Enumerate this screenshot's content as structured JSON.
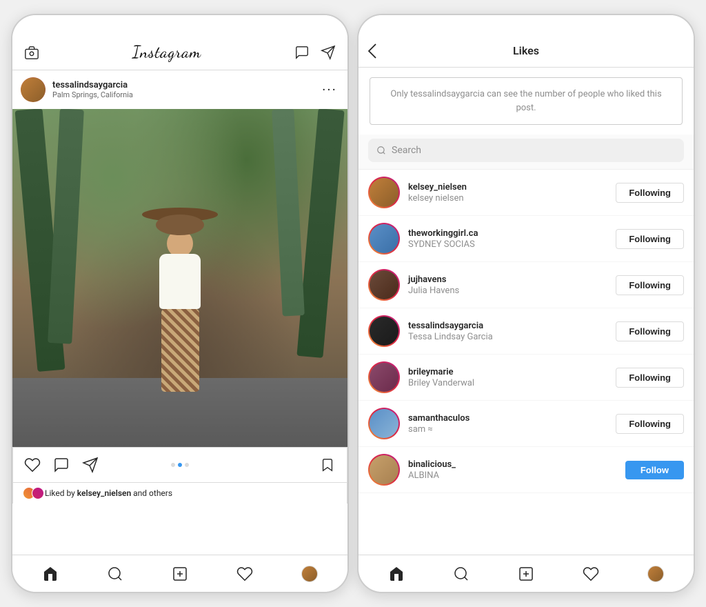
{
  "left_phone": {
    "header": {
      "logo": "Instagram",
      "icons": [
        "camera-icon",
        "paper-plane-icon",
        "filter-icon"
      ]
    },
    "post": {
      "username": "tessalindsaygarcia",
      "location": "Palm Springs, California",
      "actions": {
        "heart_label": "heart",
        "comment_label": "comment",
        "share_label": "share",
        "save_label": "save"
      },
      "dots": [
        "active",
        "inactive"
      ],
      "likes_text": "Liked by ",
      "likes_user": "kelsey_nielsen",
      "likes_suffix": " and others"
    },
    "nav": {
      "items": [
        "home",
        "search",
        "add",
        "heart",
        "profile"
      ]
    }
  },
  "right_phone": {
    "header": {
      "back_label": "‹",
      "title": "Likes"
    },
    "info_box": {
      "text": "Only tessalindsaygarcia can see the number of people\nwho liked this post."
    },
    "search": {
      "placeholder": "Search"
    },
    "users": [
      {
        "handle": "kelsey_nielsen",
        "name": "kelsey nielsen",
        "follow_status": "Following",
        "is_following": true,
        "avatar_class": "av-kelsey"
      },
      {
        "handle": "theworkinggirl.ca",
        "name": "SYDNEY SOCIAS",
        "follow_status": "Following",
        "is_following": true,
        "avatar_class": "av-working"
      },
      {
        "handle": "jujhavens",
        "name": "Julia Havens",
        "follow_status": "Following",
        "is_following": true,
        "avatar_class": "av-juj"
      },
      {
        "handle": "tessalindsaygarcia",
        "name": "Tessa Lindsay Garcia",
        "follow_status": "Following",
        "is_following": true,
        "avatar_class": "av-tessa"
      },
      {
        "handle": "brileymarie",
        "name": "Briley Vanderwal",
        "follow_status": "Following",
        "is_following": true,
        "avatar_class": "av-briley"
      },
      {
        "handle": "samanthaculos",
        "name": "sam ≈",
        "follow_status": "Following",
        "is_following": true,
        "avatar_class": "av-samantha"
      },
      {
        "handle": "binalicious_",
        "name": "ALBINA",
        "follow_status": "Follow",
        "is_following": false,
        "avatar_class": "av-bina"
      }
    ],
    "nav": {
      "items": [
        "home",
        "search",
        "add",
        "heart",
        "profile"
      ]
    }
  }
}
